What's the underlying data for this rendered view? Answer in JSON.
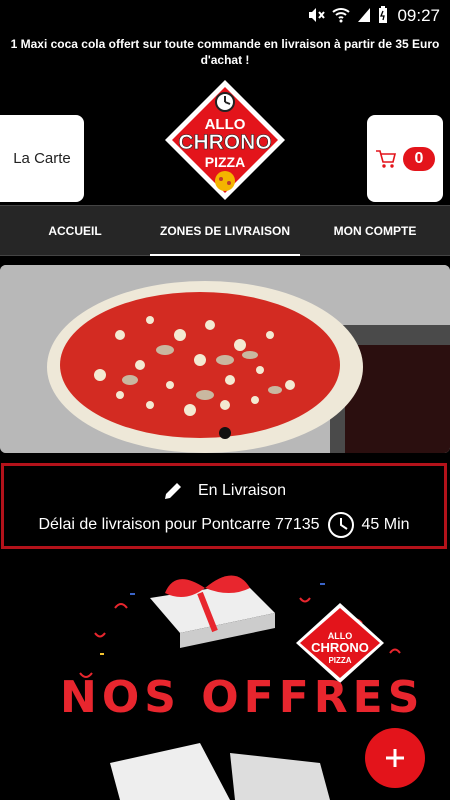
{
  "statusbar": {
    "time": "09:27"
  },
  "promo": {
    "text": "1 Maxi coca cola offert sur toute commande en livraison à partir de 35 Euro d'achat !"
  },
  "header": {
    "carte_label": "La Carte",
    "cart_count": "0",
    "logo": {
      "line1": "ALLO",
      "line2": "CHRONO",
      "line3": "PIZZA"
    }
  },
  "nav": {
    "tabs": [
      {
        "label": "ACCUEIL"
      },
      {
        "label": "ZONES DE LIVRAISON"
      },
      {
        "label": "MON COMPTE"
      }
    ]
  },
  "delivery": {
    "mode": "En Livraison",
    "delay_text": "Délai de livraison pour Pontcarre 77135",
    "delay_value": "45 Min"
  },
  "offers": {
    "title": "NOS OFFRES",
    "logo": {
      "line1": "ALLO",
      "line2": "CHRONO",
      "line3": "PIZZA"
    }
  },
  "colors": {
    "accent": "#e3141b",
    "border": "#b3121a",
    "nav_bg": "#262626"
  },
  "icons": [
    "mute-icon",
    "wifi-icon",
    "signal-icon",
    "battery-icon",
    "cart-icon",
    "pencil-icon",
    "clock-icon",
    "plus-icon"
  ]
}
